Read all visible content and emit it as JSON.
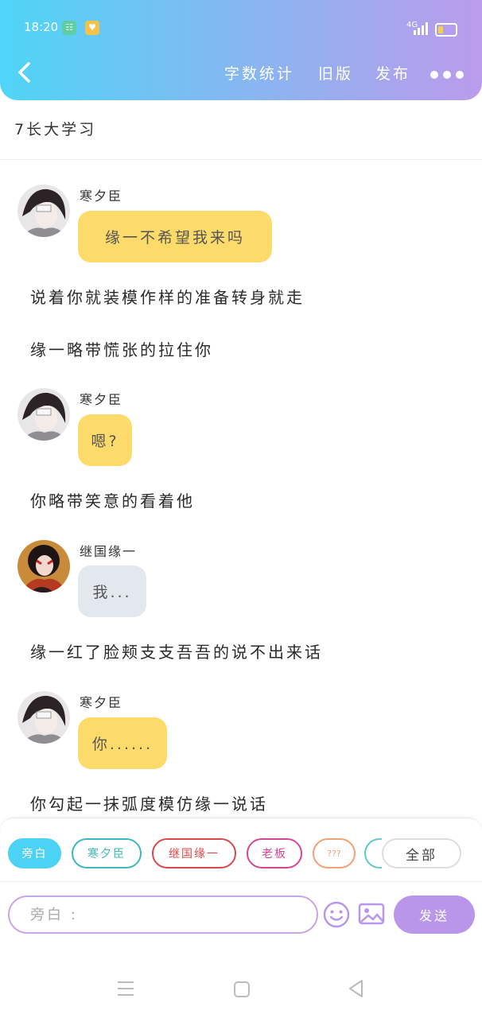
{
  "status_bar": {
    "time": "18:20",
    "app_icon_a": "☷",
    "app_icon_b": "♥",
    "network": "4G"
  },
  "header": {
    "back_icon": "chevron-left-icon",
    "word_count": "字数统计",
    "old_version": "旧版",
    "publish": "发布",
    "more_icon": "more-dots-icon"
  },
  "title": "7长大学习",
  "messages": [
    {
      "type": "dialog",
      "name": "寒夕臣",
      "text": "缘一不希望我来吗"
    },
    {
      "type": "narration",
      "text": "说着你就装模作样的准备转身就走"
    },
    {
      "type": "narration",
      "text": "缘一略带慌张的拉住你"
    },
    {
      "type": "dialog",
      "name": "寒夕臣",
      "text": "嗯?"
    },
    {
      "type": "narration",
      "text": "你略带笑意的看着他"
    },
    {
      "type": "dialog",
      "name": "继国缘一",
      "text": "我..."
    },
    {
      "type": "narration",
      "text": "缘一红了脸颊支支吾吾的说不出来话"
    },
    {
      "type": "dialog",
      "name": "寒夕臣",
      "text": "你......"
    },
    {
      "type": "narration",
      "text": "你勾起一抹弧度模仿缘一说话"
    }
  ],
  "roles": [
    {
      "label": "旁白",
      "color": "#4bd2f5",
      "active": true
    },
    {
      "label": "寒夕臣",
      "color": "#3bb8bd"
    },
    {
      "label": "继国缘一",
      "color": "#d9484a"
    },
    {
      "label": "老板",
      "color": "#d74693"
    },
    {
      "label": "???",
      "color": "#f2a172"
    }
  ],
  "role_all": "全部",
  "composer": {
    "placeholder": "旁白 :",
    "emoji_icon": "smiley-icon",
    "image_icon": "image-icon",
    "send": "发送"
  },
  "system_nav": {
    "menu_icon": "menu-icon",
    "home_icon": "home-square-icon",
    "back_icon": "back-triangle-icon"
  }
}
